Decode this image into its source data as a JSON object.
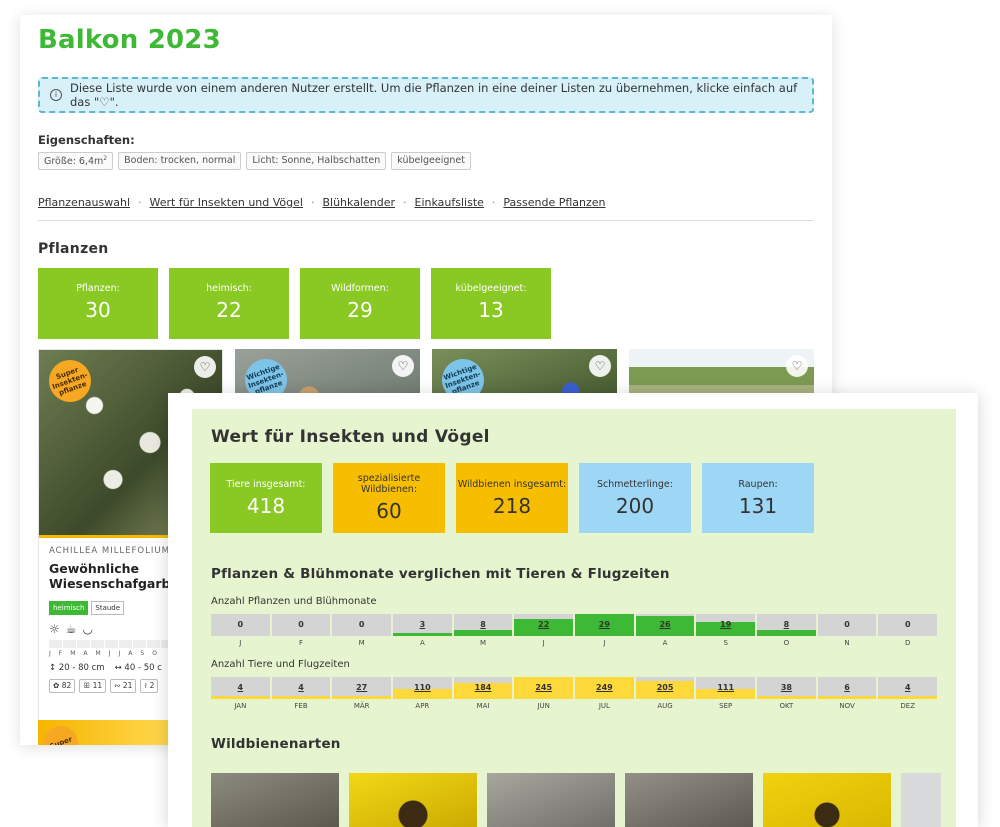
{
  "back": {
    "title": "Balkon 2023",
    "notice": "Diese Liste wurde von einem anderen Nutzer erstellt. Um die Pflanzen in eine deiner Listen zu übernehmen, klicke einfach auf das \"♡\".",
    "props_title": "Eigenschaften:",
    "chips": [
      "Größe: 6,4m",
      "Boden: trocken, normal",
      "Licht: Sonne, Halbschatten",
      "kübelgeeignet"
    ],
    "size_sup": "2",
    "nav": [
      "Pflanzenauswahl",
      "Wert für Insekten und Vögel",
      "Blühkalender",
      "Einkaufsliste",
      "Passende Pflanzen"
    ],
    "section_title": "Pflanzen",
    "stats": [
      {
        "label": "Pflanzen:",
        "value": "30"
      },
      {
        "label": "heimisch:",
        "value": "22"
      },
      {
        "label": "Wildformen:",
        "value": "29"
      },
      {
        "label": "kübelgeeignet:",
        "value": "13"
      }
    ],
    "badges": [
      "Super Insekten-pflanze",
      "Wichtige Insekten-pflanze",
      "Wichtige Insekten-pflanze",
      "Super"
    ],
    "plant": {
      "latin": "ACHILLEA MILLEFOLIUM",
      "name": "Gewöhnliche Wiesenschafgarbe",
      "tags": [
        "heimisch",
        "Staude"
      ],
      "months": [
        "J",
        "F",
        "M",
        "A",
        "M",
        "J",
        "J",
        "A",
        "S",
        "O"
      ],
      "height": "20 - 80 cm",
      "width": "40 - 50 c",
      "counts": [
        "82",
        "11",
        "21",
        "2"
      ]
    }
  },
  "front": {
    "title": "Wert für Insekten und Vögel",
    "stats": [
      {
        "label": "Tiere insgesamt:",
        "value": "418",
        "color": "green"
      },
      {
        "label": "spezialisierte Wildbienen:",
        "value": "60",
        "color": "yellow"
      },
      {
        "label": "Wildbienen insgesamt:",
        "value": "218",
        "color": "yellow"
      },
      {
        "label": "Schmetterlinge:",
        "value": "200",
        "color": "blue"
      },
      {
        "label": "Raupen:",
        "value": "131",
        "color": "blue"
      }
    ],
    "compare_title": "Pflanzen & Blühmonate verglichen mit Tieren & Flugzeiten",
    "plants_label": "Anzahl Pflanzen und Blühmonate",
    "plants_months": [
      "J",
      "F",
      "M",
      "A",
      "M",
      "J",
      "J",
      "A",
      "S",
      "O",
      "N",
      "D"
    ],
    "plants_values": [
      0,
      0,
      0,
      3,
      8,
      22,
      29,
      26,
      19,
      8,
      0,
      0
    ],
    "plants_max": 29,
    "animals_label": "Anzahl Tiere und Flugzeiten",
    "animals_months": [
      "JAN",
      "FEB",
      "MÄR",
      "APR",
      "MAI",
      "JUN",
      "JUL",
      "AUG",
      "SEP",
      "OKT",
      "NOV",
      "DEZ"
    ],
    "animals_values": [
      4,
      4,
      27,
      110,
      184,
      245,
      249,
      205,
      111,
      38,
      6,
      4
    ],
    "animals_max": 249,
    "bees_title": "Wildbienenarten"
  }
}
